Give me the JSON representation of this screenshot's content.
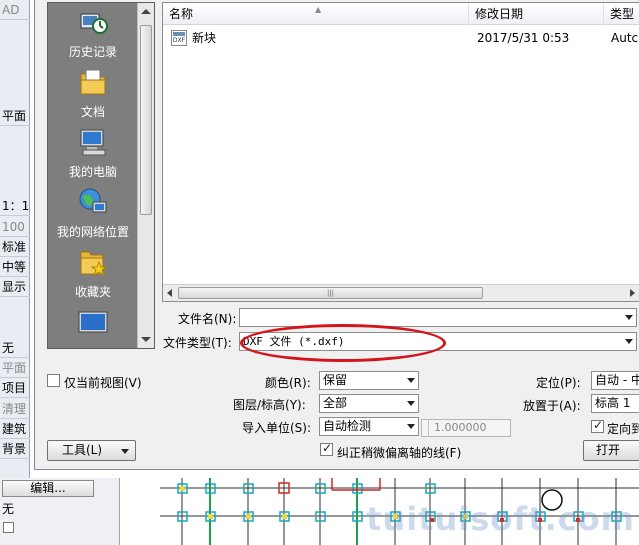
{
  "background_app": {
    "top_label": "AD",
    "side_rows": [
      "平面",
      "1：1",
      "100",
      "标准",
      "中等",
      "显示",
      "无",
      "平面",
      "项目",
      "清理",
      "建筑",
      "背景"
    ],
    "edit_button": "编辑...",
    "none_label": "无",
    "watermark": "tuituisoft.com"
  },
  "dialog": {
    "places": [
      {
        "label": "历史记录",
        "icon": "history-icon"
      },
      {
        "label": "文档",
        "icon": "documents-folder-icon"
      },
      {
        "label": "我的电脑",
        "icon": "my-computer-icon"
      },
      {
        "label": "我的网络位置",
        "icon": "network-places-icon"
      },
      {
        "label": "收藏夹",
        "icon": "favorites-folder-icon"
      },
      {
        "label": "",
        "icon": "desktop-icon"
      }
    ],
    "columns": {
      "name": "名称",
      "date": "修改日期",
      "type": "类型"
    },
    "files": [
      {
        "name": "新块",
        "date": "2017/5/31 0:53",
        "type": "Autc",
        "icon": "dxf-file-icon"
      }
    ],
    "filename_label": "文件名(N):",
    "filename_value": "",
    "filetype_label": "文件类型(T):",
    "filetype_value": "DXF 文件 (*.dxf)",
    "current_view_only": {
      "label": "仅当前视图(V)",
      "checked": false
    },
    "color": {
      "label": "颜色(R):",
      "value": "保留"
    },
    "layers": {
      "label": "图层/标高(Y):",
      "value": "全部"
    },
    "import_units": {
      "label": "导入单位(S):",
      "value": "自动检测",
      "factor": "1.000000"
    },
    "correct_lines": {
      "label": "纠正稍微偏离轴的线(F)",
      "checked": true
    },
    "positioning": {
      "label": "定位(P):",
      "value": "自动 - 中"
    },
    "place_at": {
      "label": "放置于(A):",
      "value": "标高 1"
    },
    "orient": {
      "label": "定向到",
      "checked": true
    },
    "tools_button": "工具(L)",
    "open_button": "打开"
  },
  "annotation": {
    "color": "#d4141a"
  }
}
